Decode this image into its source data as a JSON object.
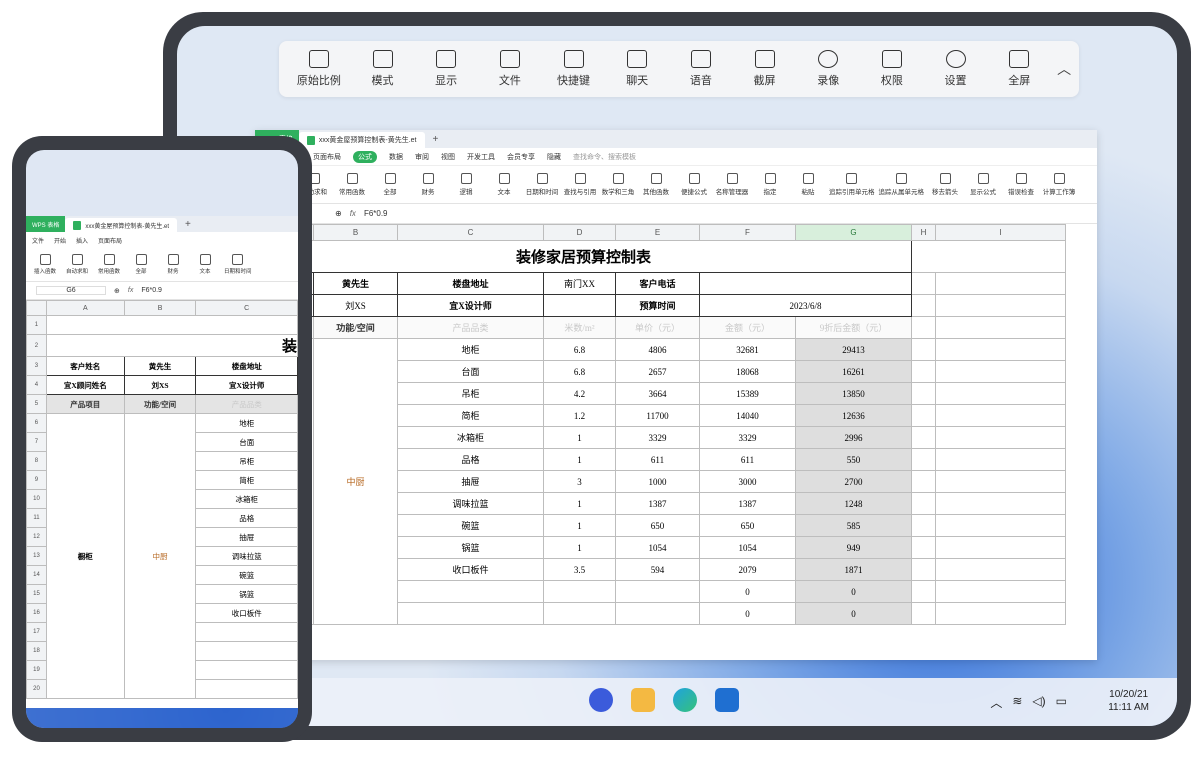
{
  "toolbar": {
    "items": [
      {
        "label": "原始比例",
        "icon": "aspect-ratio-icon"
      },
      {
        "label": "模式",
        "icon": "grid-mode-icon"
      },
      {
        "label": "显示",
        "icon": "display-icon"
      },
      {
        "label": "文件",
        "icon": "folder-icon"
      },
      {
        "label": "快捷键",
        "icon": "keyboard-icon"
      },
      {
        "label": "聊天",
        "icon": "chat-icon"
      },
      {
        "label": "语音",
        "icon": "phone-icon"
      },
      {
        "label": "截屏",
        "icon": "scissors-icon"
      },
      {
        "label": "录像",
        "icon": "record-icon"
      },
      {
        "label": "权限",
        "icon": "permission-icon"
      },
      {
        "label": "设置",
        "icon": "gear-icon"
      },
      {
        "label": "全屏",
        "icon": "fullscreen-icon"
      }
    ],
    "collapse": "︿"
  },
  "wps": {
    "brand": "WPS 表格",
    "doc_tab": "xxx黄金屋预算控制表-黄先生.et",
    "phone_doc_tab": "xxx黄金屋预算控制表-黄先生.et",
    "plus": "+",
    "menu": [
      "开始",
      "插入",
      "页面布局",
      "公式",
      "数据",
      "审阅",
      "视图",
      "开发工具",
      "会员专享",
      "隐藏"
    ],
    "menu_active_index": 3,
    "search": "查找命令、搜索模板",
    "phone_menu": [
      "文件",
      "开始",
      "插入",
      "页面布局"
    ],
    "ribbon": [
      "插入函数",
      "自动求和",
      "常用函数",
      "全部",
      "财务",
      "逻辑",
      "文本",
      "日期和时间",
      "查找与引用",
      "数学和三角",
      "其他函数",
      "便捷公式",
      "名称管理器",
      "指定",
      "粘贴",
      "追踪引用单元格",
      "追踪从属单元格",
      "移去箭头",
      "显示公式",
      "错误检查",
      "计算工作簿"
    ],
    "phone_ribbon": [
      "插入函数",
      "自动求和",
      "常用函数",
      "全部",
      "财务",
      "文本",
      "日期和时间"
    ],
    "formula": "fx",
    "formula_value": "F6*0.9",
    "cell_ref": "G6"
  },
  "sheet": {
    "columns": [
      "A",
      "B",
      "C",
      "D",
      "E",
      "F",
      "G",
      "H",
      "I"
    ],
    "title": "装修家居预算控制表",
    "phone_title": "装",
    "info": {
      "customer_label": "户姓名",
      "customer_label_full": "客户姓名",
      "customer": "黄先生",
      "address_label": "楼盘地址",
      "address": "南门XX",
      "phone_label": "客户电话",
      "consultant_label": "顾问姓名",
      "consultant_label_full": "宜X顾问姓名",
      "consultant": "刘XS",
      "designer": "宜X设计师",
      "budget_time_label": "预算时间",
      "budget_time": "2023/6/8",
      "item_label": "品项目",
      "item_label_full": "产品项目",
      "space_label": "功能/空间"
    },
    "table_header": [
      "产品品类",
      "米数/m²",
      "单价（元）",
      "金额（元）",
      "9折后金额（元）"
    ],
    "group": {
      "item": "橱柜",
      "space": "中厨"
    },
    "rows": [
      {
        "name": "地柜",
        "qty": "6.8",
        "price": "4806",
        "amount": "32681",
        "discount": "29413"
      },
      {
        "name": "台面",
        "qty": "6.8",
        "price": "2657",
        "amount": "18068",
        "discount": "16261"
      },
      {
        "name": "吊柜",
        "qty": "4.2",
        "price": "3664",
        "amount": "15389",
        "discount": "13850"
      },
      {
        "name": "简柜",
        "qty": "1.2",
        "price": "11700",
        "amount": "14040",
        "discount": "12636"
      },
      {
        "name": "冰箱柜",
        "qty": "1",
        "price": "3329",
        "amount": "3329",
        "discount": "2996"
      },
      {
        "name": "品格",
        "qty": "1",
        "price": "611",
        "amount": "611",
        "discount": "550"
      },
      {
        "name": "抽屉",
        "qty": "3",
        "price": "1000",
        "amount": "3000",
        "discount": "2700"
      },
      {
        "name": "调味拉篮",
        "qty": "1",
        "price": "1387",
        "amount": "1387",
        "discount": "1248"
      },
      {
        "name": "碗篮",
        "qty": "1",
        "price": "650",
        "amount": "650",
        "discount": "585"
      },
      {
        "name": "锅篮",
        "qty": "1",
        "price": "1054",
        "amount": "1054",
        "discount": "949"
      },
      {
        "name": "收口板件",
        "qty": "3.5",
        "price": "594",
        "amount": "2079",
        "discount": "1871"
      },
      {
        "name": "",
        "qty": "",
        "price": "",
        "amount": "0",
        "discount": "0"
      },
      {
        "name": "",
        "qty": "",
        "price": "",
        "amount": "0",
        "discount": "0"
      }
    ]
  },
  "taskbar": {
    "clock_date": "10/20/21",
    "clock_time": "11:11 AM",
    "tray": [
      "^",
      "wifi",
      "speaker",
      "battery"
    ]
  }
}
